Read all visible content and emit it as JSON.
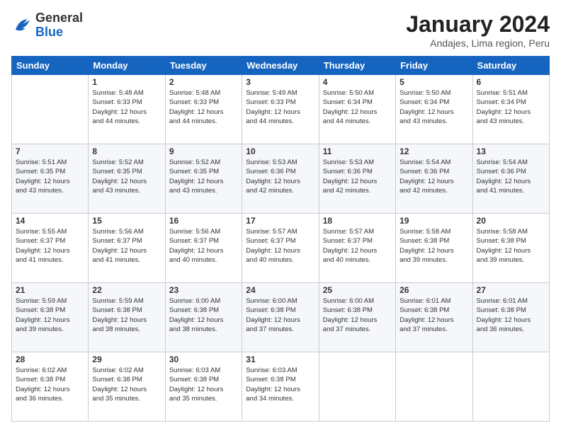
{
  "logo": {
    "general": "General",
    "blue": "Blue"
  },
  "title": "January 2024",
  "subtitle": "Andajes, Lima region, Peru",
  "days_header": [
    "Sunday",
    "Monday",
    "Tuesday",
    "Wednesday",
    "Thursday",
    "Friday",
    "Saturday"
  ],
  "weeks": [
    [
      {
        "day": "",
        "info": ""
      },
      {
        "day": "1",
        "info": "Sunrise: 5:48 AM\nSunset: 6:33 PM\nDaylight: 12 hours\nand 44 minutes."
      },
      {
        "day": "2",
        "info": "Sunrise: 5:48 AM\nSunset: 6:33 PM\nDaylight: 12 hours\nand 44 minutes."
      },
      {
        "day": "3",
        "info": "Sunrise: 5:49 AM\nSunset: 6:33 PM\nDaylight: 12 hours\nand 44 minutes."
      },
      {
        "day": "4",
        "info": "Sunrise: 5:50 AM\nSunset: 6:34 PM\nDaylight: 12 hours\nand 44 minutes."
      },
      {
        "day": "5",
        "info": "Sunrise: 5:50 AM\nSunset: 6:34 PM\nDaylight: 12 hours\nand 43 minutes."
      },
      {
        "day": "6",
        "info": "Sunrise: 5:51 AM\nSunset: 6:34 PM\nDaylight: 12 hours\nand 43 minutes."
      }
    ],
    [
      {
        "day": "7",
        "info": "Sunrise: 5:51 AM\nSunset: 6:35 PM\nDaylight: 12 hours\nand 43 minutes."
      },
      {
        "day": "8",
        "info": "Sunrise: 5:52 AM\nSunset: 6:35 PM\nDaylight: 12 hours\nand 43 minutes."
      },
      {
        "day": "9",
        "info": "Sunrise: 5:52 AM\nSunset: 6:35 PM\nDaylight: 12 hours\nand 43 minutes."
      },
      {
        "day": "10",
        "info": "Sunrise: 5:53 AM\nSunset: 6:36 PM\nDaylight: 12 hours\nand 42 minutes."
      },
      {
        "day": "11",
        "info": "Sunrise: 5:53 AM\nSunset: 6:36 PM\nDaylight: 12 hours\nand 42 minutes."
      },
      {
        "day": "12",
        "info": "Sunrise: 5:54 AM\nSunset: 6:36 PM\nDaylight: 12 hours\nand 42 minutes."
      },
      {
        "day": "13",
        "info": "Sunrise: 5:54 AM\nSunset: 6:36 PM\nDaylight: 12 hours\nand 41 minutes."
      }
    ],
    [
      {
        "day": "14",
        "info": "Sunrise: 5:55 AM\nSunset: 6:37 PM\nDaylight: 12 hours\nand 41 minutes."
      },
      {
        "day": "15",
        "info": "Sunrise: 5:56 AM\nSunset: 6:37 PM\nDaylight: 12 hours\nand 41 minutes."
      },
      {
        "day": "16",
        "info": "Sunrise: 5:56 AM\nSunset: 6:37 PM\nDaylight: 12 hours\nand 40 minutes."
      },
      {
        "day": "17",
        "info": "Sunrise: 5:57 AM\nSunset: 6:37 PM\nDaylight: 12 hours\nand 40 minutes."
      },
      {
        "day": "18",
        "info": "Sunrise: 5:57 AM\nSunset: 6:37 PM\nDaylight: 12 hours\nand 40 minutes."
      },
      {
        "day": "19",
        "info": "Sunrise: 5:58 AM\nSunset: 6:38 PM\nDaylight: 12 hours\nand 39 minutes."
      },
      {
        "day": "20",
        "info": "Sunrise: 5:58 AM\nSunset: 6:38 PM\nDaylight: 12 hours\nand 39 minutes."
      }
    ],
    [
      {
        "day": "21",
        "info": "Sunrise: 5:59 AM\nSunset: 6:38 PM\nDaylight: 12 hours\nand 39 minutes."
      },
      {
        "day": "22",
        "info": "Sunrise: 5:59 AM\nSunset: 6:38 PM\nDaylight: 12 hours\nand 38 minutes."
      },
      {
        "day": "23",
        "info": "Sunrise: 6:00 AM\nSunset: 6:38 PM\nDaylight: 12 hours\nand 38 minutes."
      },
      {
        "day": "24",
        "info": "Sunrise: 6:00 AM\nSunset: 6:38 PM\nDaylight: 12 hours\nand 37 minutes."
      },
      {
        "day": "25",
        "info": "Sunrise: 6:00 AM\nSunset: 6:38 PM\nDaylight: 12 hours\nand 37 minutes."
      },
      {
        "day": "26",
        "info": "Sunrise: 6:01 AM\nSunset: 6:38 PM\nDaylight: 12 hours\nand 37 minutes."
      },
      {
        "day": "27",
        "info": "Sunrise: 6:01 AM\nSunset: 6:38 PM\nDaylight: 12 hours\nand 36 minutes."
      }
    ],
    [
      {
        "day": "28",
        "info": "Sunrise: 6:02 AM\nSunset: 6:38 PM\nDaylight: 12 hours\nand 36 minutes."
      },
      {
        "day": "29",
        "info": "Sunrise: 6:02 AM\nSunset: 6:38 PM\nDaylight: 12 hours\nand 35 minutes."
      },
      {
        "day": "30",
        "info": "Sunrise: 6:03 AM\nSunset: 6:38 PM\nDaylight: 12 hours\nand 35 minutes."
      },
      {
        "day": "31",
        "info": "Sunrise: 6:03 AM\nSunset: 6:38 PM\nDaylight: 12 hours\nand 34 minutes."
      },
      {
        "day": "",
        "info": ""
      },
      {
        "day": "",
        "info": ""
      },
      {
        "day": "",
        "info": ""
      }
    ]
  ]
}
